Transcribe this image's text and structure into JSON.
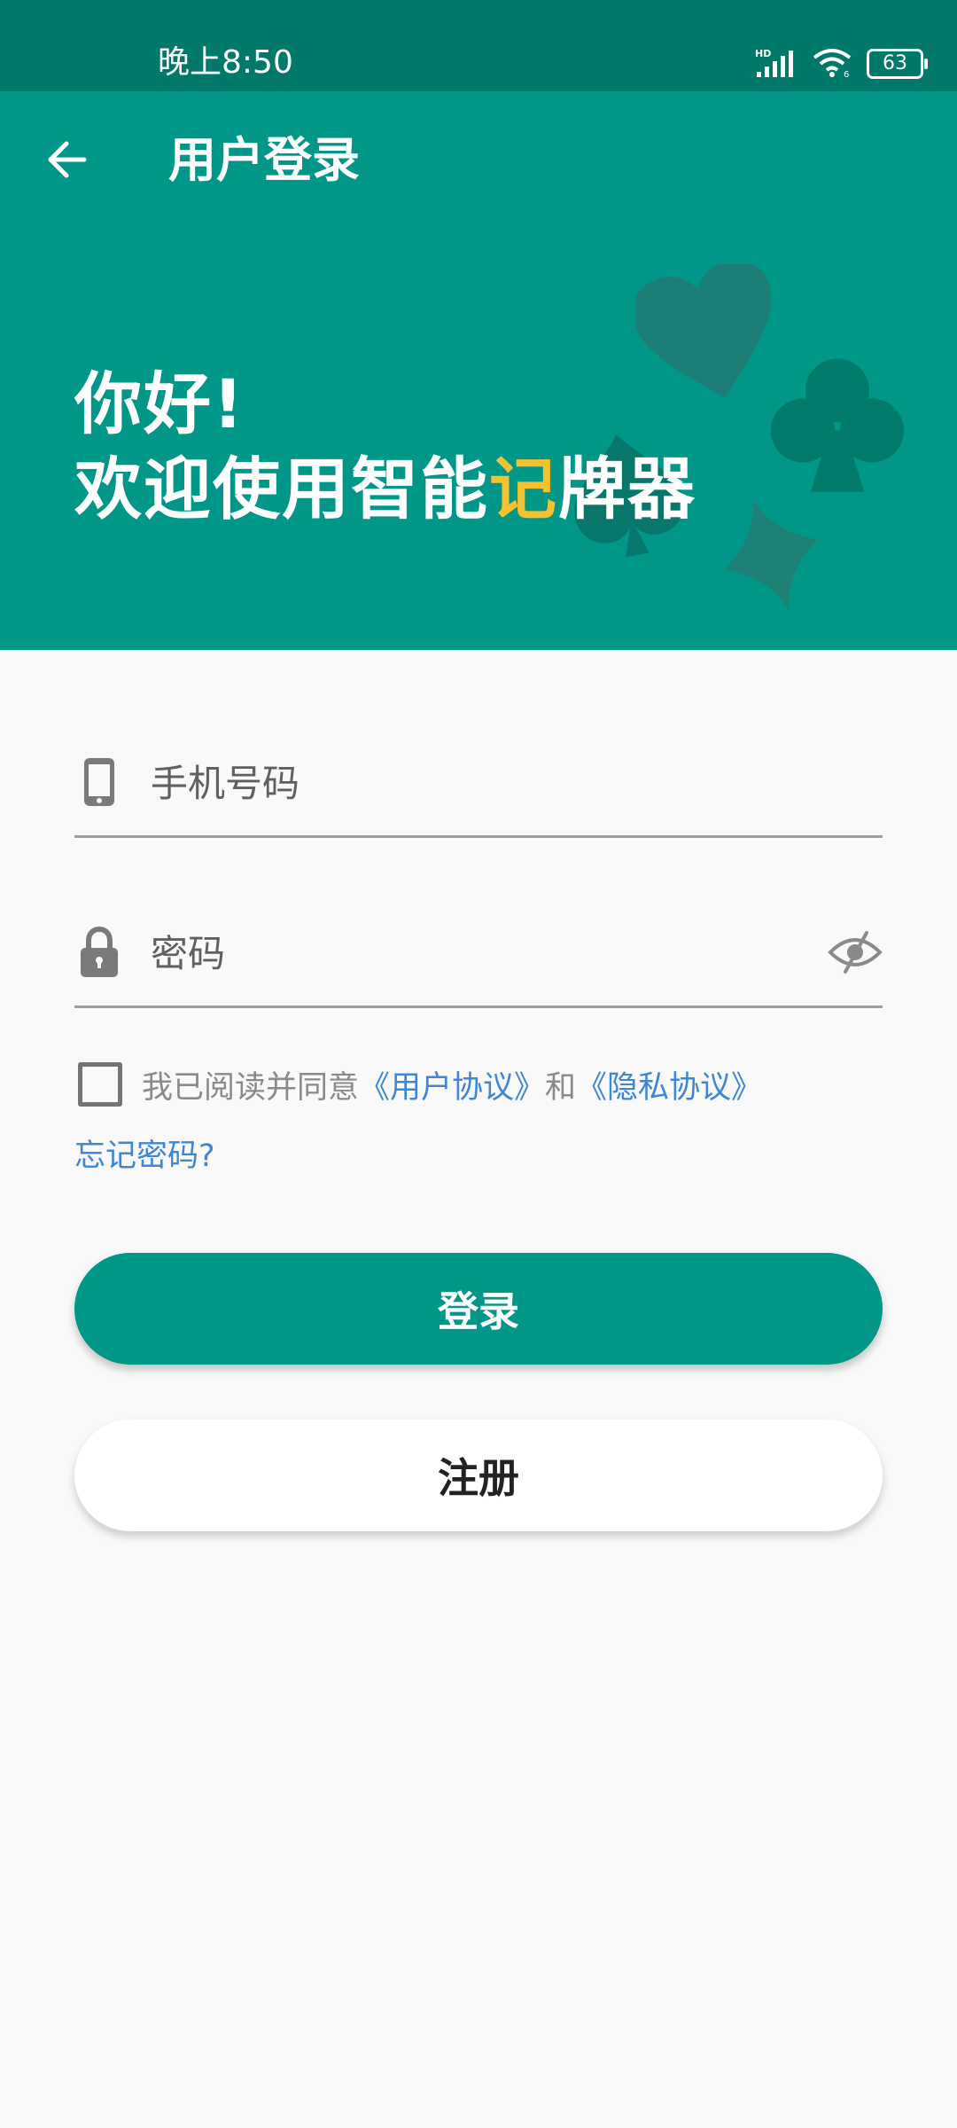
{
  "status_bar": {
    "time": "晚上8:50",
    "battery": "63",
    "icons": [
      "hd-signal-icon",
      "wifi-icon",
      "battery-icon"
    ]
  },
  "app_bar": {
    "title": "用户登录",
    "back_icon": "arrow-left-icon"
  },
  "hero": {
    "line1": "你好!",
    "line2_prefix": "欢迎使用智能",
    "line2_highlight": "记",
    "line2_suffix": "牌器",
    "decorations": [
      "heart-icon",
      "club-icon",
      "spade-icon",
      "diamond-icon"
    ]
  },
  "form": {
    "phone_placeholder": "手机号码",
    "password_placeholder": "密码",
    "phone_icon": "phone-icon",
    "password_icon": "lock-icon",
    "visibility_icon": "eye-off-icon"
  },
  "agreement": {
    "prefix": "我已阅读并同意",
    "user_agreement": "《用户协议》",
    "and": "和",
    "privacy_agreement": "《隐私协议》",
    "checked": false
  },
  "forgot_password": "忘记密码?",
  "buttons": {
    "login": "登录",
    "register": "注册"
  },
  "colors": {
    "status_bar": "#00796b",
    "primary": "#009688",
    "highlight": "#f5c12f",
    "link": "#3f86d4",
    "background": "#f9f9f9"
  }
}
